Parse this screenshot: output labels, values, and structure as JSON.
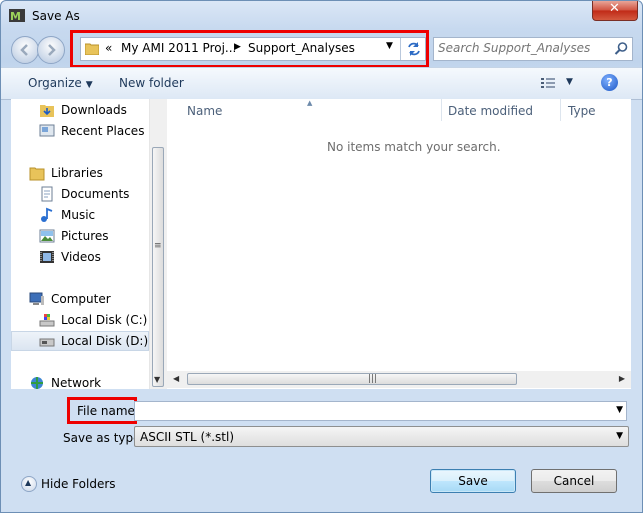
{
  "window": {
    "title": "Save As",
    "close_glyph": "✕"
  },
  "address": {
    "prefix": "«",
    "crumbs": [
      "My AMI 2011 Proj...",
      "Support_Analyses"
    ],
    "separator": "▶",
    "dropdown": "▼"
  },
  "search": {
    "placeholder": "Search Support_Analyses"
  },
  "toolbar": {
    "organize": "Organize",
    "organize_arrow": "▼",
    "new_folder": "New folder",
    "views_arrow": "▼",
    "help": "?"
  },
  "nav": {
    "downloads": "Downloads",
    "recent_places": "Recent Places",
    "libraries": "Libraries",
    "documents": "Documents",
    "music": "Music",
    "pictures": "Pictures",
    "videos": "Videos",
    "computer": "Computer",
    "local_disk_c": "Local Disk (C:)",
    "local_disk_d": "Local Disk (D:)",
    "network": "Network"
  },
  "files": {
    "columns": [
      "Name",
      "Date modified",
      "Type"
    ],
    "empty_message": "No items match your search."
  },
  "form": {
    "file_name_label": "File name:",
    "file_name_value": "",
    "save_type_label": "Save as type:",
    "save_type_value": "ASCII STL (*.stl)"
  },
  "footer": {
    "hide_folders": "Hide Folders",
    "save": "Save",
    "cancel": "Cancel"
  },
  "colors": {
    "highlight_box": "#e00000",
    "primary_button": "#bee6fd"
  }
}
